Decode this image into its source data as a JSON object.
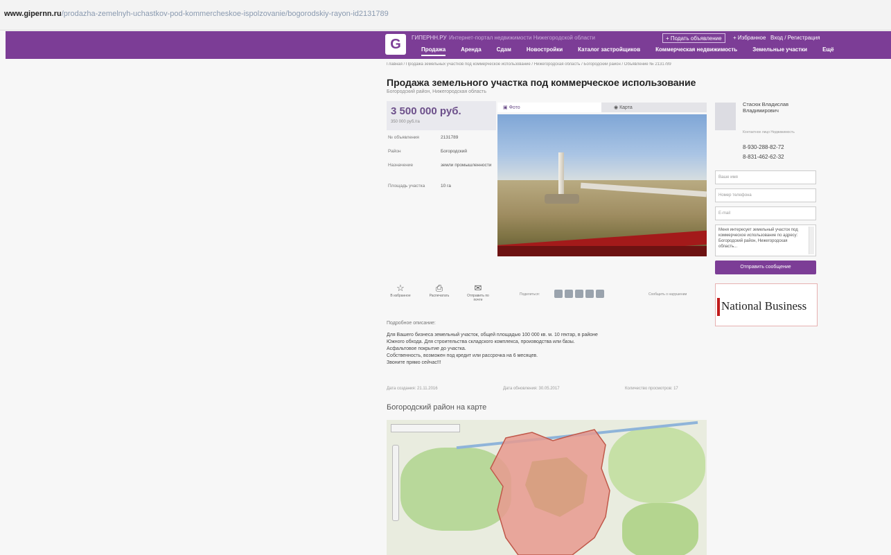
{
  "browser": {
    "url_host": "www.gipernn.ru",
    "url_path": "/prodazha-zemelnyh-uchastkov-pod-kommercheskoe-ispolzovanie/bogorodskiy-rayon-id2131789"
  },
  "header": {
    "brand": "ГИПЕРНН.РУ",
    "tagline": "Интернет-портал недвижимости Нижегородской области",
    "submit_ad": "+ Подать объявление",
    "favorites": "+ Избранное",
    "login": "Вход / Регистрация",
    "nav": [
      "Продажа",
      "Аренда",
      "Сдам",
      "Новостройки",
      "Каталог застройщиков",
      "Коммерческая недвижимость",
      "Земельные участки",
      "Ещё"
    ]
  },
  "breadcrumb": "Главная / Продажа земельных участков под коммерческое использование / Нижегородская область / Богородский район / Объявление № 2131789",
  "listing": {
    "title": "Продажа земельного участка под коммерческое использование",
    "subtitle": "Богородский район, Нижегородская область",
    "price": "3 500 000 руб.",
    "price_sub": "350 000 руб./га",
    "params": [
      {
        "key": "№ объявления",
        "value": "2131789"
      },
      {
        "key": "Район",
        "value": "Богородский"
      },
      {
        "key": "Назначение",
        "value": "земли промышленности"
      },
      {
        "key": "Площадь участка",
        "value": "10 га"
      }
    ],
    "tab_photo": "Фото",
    "tab_map": "Карта"
  },
  "seller": {
    "name": "Стасюк Владислав Владимирович",
    "note": "Контактное лицо Недвижимость",
    "phone1": "8-930-288-82-72",
    "phone2": "8-831-462-62-32"
  },
  "contact_form": {
    "name_placeholder": "Ваше имя",
    "phone_placeholder": "Номер телефона",
    "email_placeholder": "E-mail",
    "message": "Меня интересует земельный участок под коммерческое использование по адресу: Богородский район, Нижегородская область...",
    "send": "Отправить сообщение"
  },
  "banner": {
    "text": "National Business"
  },
  "actions": {
    "favorite": "В избранное",
    "print": "Распечатать",
    "send_friend": "Отправить по почте",
    "share_label": "Поделиться:",
    "complaint": "Сообщить о нарушении"
  },
  "description": {
    "heading": "Подробное описание:",
    "lines": [
      "Для Вашего бизнеса земельный участок, общей площадью 100 000 кв. м. 10 гектар, в районе",
      "Южного обхода. Для строительства складского комплекса, производства или базы.",
      "Асфальтовое покрытие до участка.",
      "Собственность, возможен под кредит или рассрочка на 6 месяцев.",
      "Звоните прямо сейчас!!!"
    ]
  },
  "meta": {
    "created": "Дата создания: 21.11.2016",
    "updated": "Дата обновления: 30.05.2017",
    "views": "Количество просмотров: 17"
  },
  "map": {
    "heading": "Богородский район на карте"
  }
}
